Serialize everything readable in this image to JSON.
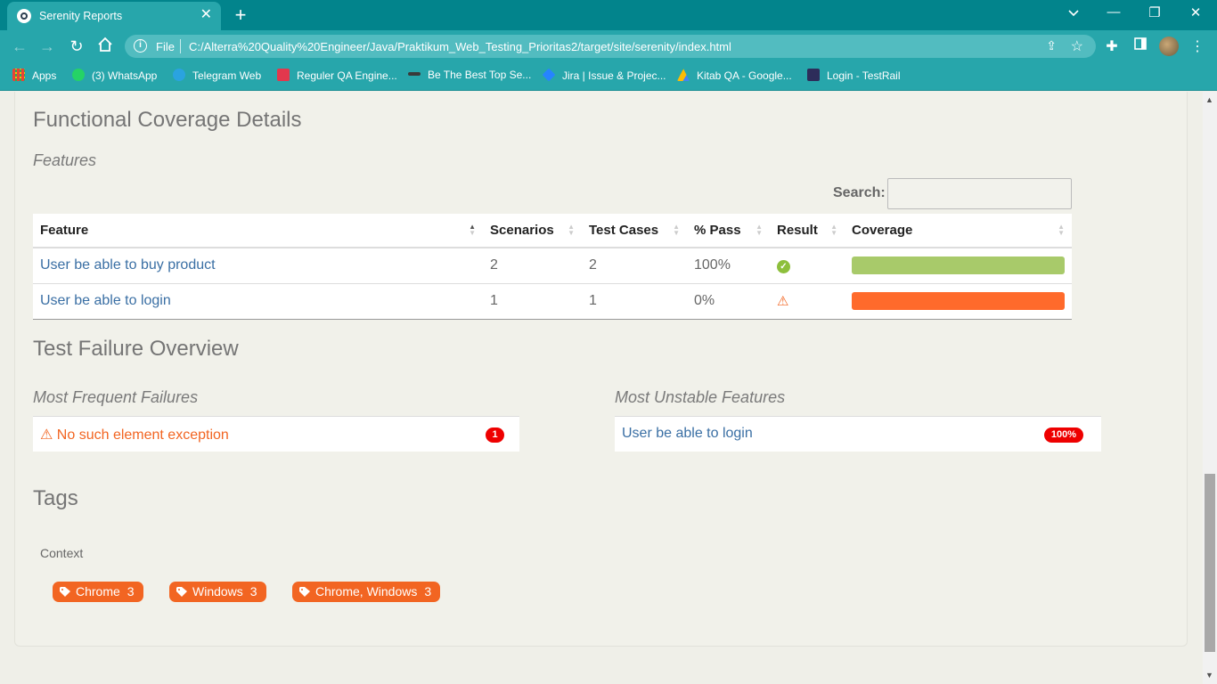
{
  "browser": {
    "tab_title": "Serenity Reports",
    "tab_close": "✕",
    "new_tab": "+",
    "win_min": "—",
    "win_restore": "❐",
    "win_close": "✕",
    "scheme": "File",
    "url": "C:/Alterra%20Quality%20Engineer/Java/Praktikum_Web_Testing_Prioritas2/target/site/serenity/index.html",
    "bookmarks": [
      {
        "label": "Apps",
        "icon": "apps-grid-icon",
        "color": "#f4b400"
      },
      {
        "label": "(3) WhatsApp",
        "icon": "whatsapp-icon",
        "color": "#25d366"
      },
      {
        "label": "Telegram Web",
        "icon": "telegram-icon",
        "color": "#2aa3e0"
      },
      {
        "label": "Reguler QA Engine...",
        "icon": "bookmark-page-icon",
        "color": "#e2384d"
      },
      {
        "label": "Be The Best Top Se...",
        "icon": "bookmark-page-icon",
        "color": "#3a3a3a"
      },
      {
        "label": "Jira | Issue & Projec...",
        "icon": "jira-icon",
        "color": "#2684ff"
      },
      {
        "label": "Kitab QA - Google...",
        "icon": "google-drive-icon",
        "color": "#fbbc04"
      },
      {
        "label": "Login - TestRail",
        "icon": "testrail-icon",
        "color": "#2d2d5a"
      }
    ]
  },
  "page": {
    "coverage_title": "Functional Coverage Details",
    "features_subtitle": "Features",
    "search_label": "Search:",
    "search_placeholder": "",
    "table": {
      "headers": [
        "Feature",
        "Scenarios",
        "Test Cases",
        "% Pass",
        "Result",
        "Coverage"
      ],
      "rows": [
        {
          "feature": "User be able to buy product",
          "scenarios": "2",
          "test_cases": "2",
          "pass": "100%",
          "result": "success",
          "coverage_pass_fraction": 1.0,
          "coverage_color": "#a8ca6a"
        },
        {
          "feature": "User be able to login",
          "scenarios": "1",
          "test_cases": "1",
          "pass": "0%",
          "result": "failure",
          "coverage_pass_fraction": 0.0,
          "coverage_color": "#ff6a2b"
        }
      ]
    },
    "failure_title": "Test Failure Overview",
    "frequent_title": "Most Frequent Failures",
    "frequent_failures": [
      {
        "label": "No such element exception",
        "count": "1"
      }
    ],
    "unstable_title": "Most Unstable Features",
    "unstable_features": [
      {
        "label": "User be able to login",
        "percent": "100%"
      }
    ],
    "tags_title": "Tags",
    "tags_context": "Context",
    "tags": [
      {
        "label": "Chrome",
        "count": "3"
      },
      {
        "label": "Windows",
        "count": "3"
      },
      {
        "label": "Chrome, Windows",
        "count": "3"
      }
    ]
  },
  "colors": {
    "brand_teal": "#02848c",
    "pass_green": "#a8ca6a",
    "fail_orange": "#f26522",
    "badge_red": "#e00000",
    "link_blue": "#3a6fa4"
  }
}
